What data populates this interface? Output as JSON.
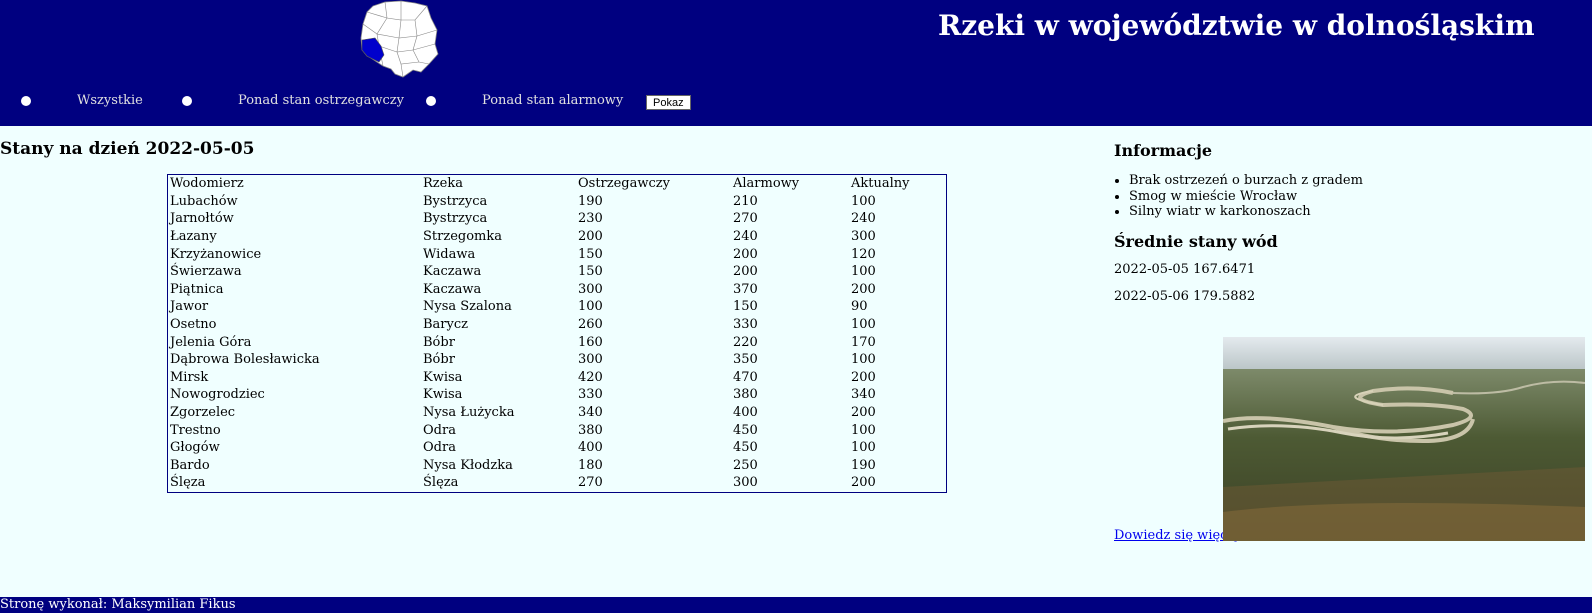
{
  "header": {
    "title": "Rzeki w województwie w dolnośląskim"
  },
  "filters": {
    "options": [
      {
        "label": "Wszystkie"
      },
      {
        "label": "Ponad stan ostrzegawczy"
      },
      {
        "label": "Ponad stan alarmowy"
      }
    ],
    "submit_label": "Pokaz"
  },
  "main": {
    "date_heading": "Stany na dzień 2022-05-05",
    "table": {
      "columns": [
        "Wodomierz",
        "Rzeka",
        "Ostrzegawczy",
        "Alarmowy",
        "Aktualny"
      ],
      "rows": [
        [
          "Lubachów",
          "Bystrzyca",
          "190",
          "210",
          "100"
        ],
        [
          "Jarnołtów",
          "Bystrzyca",
          "230",
          "270",
          "240"
        ],
        [
          "Łazany",
          "Strzegomka",
          "200",
          "240",
          "300"
        ],
        [
          "Krzyżanowice",
          "Widawa",
          "150",
          "200",
          "120"
        ],
        [
          "Świerzawa",
          "Kaczawa",
          "150",
          "200",
          "100"
        ],
        [
          "Piątnica",
          "Kaczawa",
          "300",
          "370",
          "200"
        ],
        [
          "Jawor",
          "Nysa Szalona",
          "100",
          "150",
          "90"
        ],
        [
          "Osetno",
          "Barycz",
          "260",
          "330",
          "100"
        ],
        [
          "Jelenia Góra",
          "Bóbr",
          "160",
          "220",
          "170"
        ],
        [
          "Dąbrowa Bolesławicka",
          "Bóbr",
          "300",
          "350",
          "100"
        ],
        [
          "Mirsk",
          "Kwisa",
          "420",
          "470",
          "200"
        ],
        [
          "Nowogrodziec",
          "Kwisa",
          "330",
          "380",
          "340"
        ],
        [
          "Zgorzelec",
          "Nysa Łużycka",
          "340",
          "400",
          "200"
        ],
        [
          "Trestno",
          "Odra",
          "380",
          "450",
          "100"
        ],
        [
          "Głogów",
          "Odra",
          "400",
          "450",
          "100"
        ],
        [
          "Bardo",
          "Nysa Kłodzka",
          "180",
          "250",
          "190"
        ],
        [
          "Ślęza",
          "Ślęza",
          "270",
          "300",
          "200"
        ]
      ]
    }
  },
  "sidebar": {
    "info_heading": "Informacje",
    "info_items": [
      "Brak ostrzezeń o burzach z gradem",
      "Smog w mieście Wrocław",
      "Silny wiatr w karkonoszach"
    ],
    "avg_heading": "Średnie stany wód",
    "averages": [
      "2022-05-05 167.6471",
      "2022-05-06 179.5882"
    ],
    "more_link": "Dowiedz się więcej"
  },
  "footer": {
    "text": "Stronę wykonał: Maksymilian Fikus"
  },
  "colors": {
    "banner": "#000080",
    "page_background": "#f0ffff",
    "map_highlight": "#0000cc"
  }
}
